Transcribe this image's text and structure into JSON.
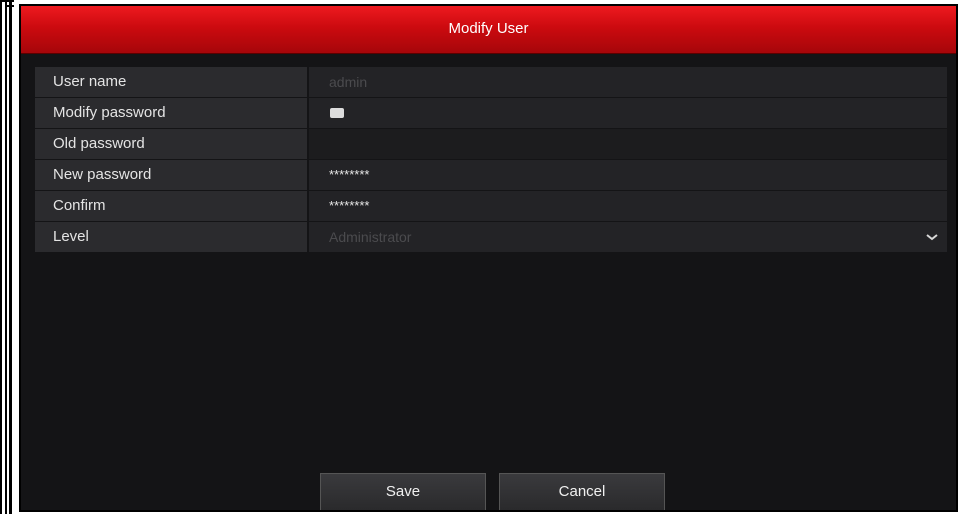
{
  "dialog": {
    "title": "Modify User"
  },
  "form": {
    "rows": [
      {
        "label": "User name",
        "value": "admin"
      },
      {
        "label": "Modify password",
        "checkbox_checked": true
      },
      {
        "label": "Old password",
        "value": ""
      },
      {
        "label": "New password",
        "value": "********"
      },
      {
        "label": "Confirm",
        "value": "********"
      },
      {
        "label": "Level",
        "value": "Administrator",
        "icon": "chevron-down-icon"
      }
    ]
  },
  "buttons": {
    "save_label": "Save",
    "cancel_label": "Cancel"
  },
  "colors": {
    "title_bar": "#cc0a0f",
    "dialog_bg": "#141416",
    "label_bg": "#2b2b2e",
    "value_bg": "#232326"
  }
}
